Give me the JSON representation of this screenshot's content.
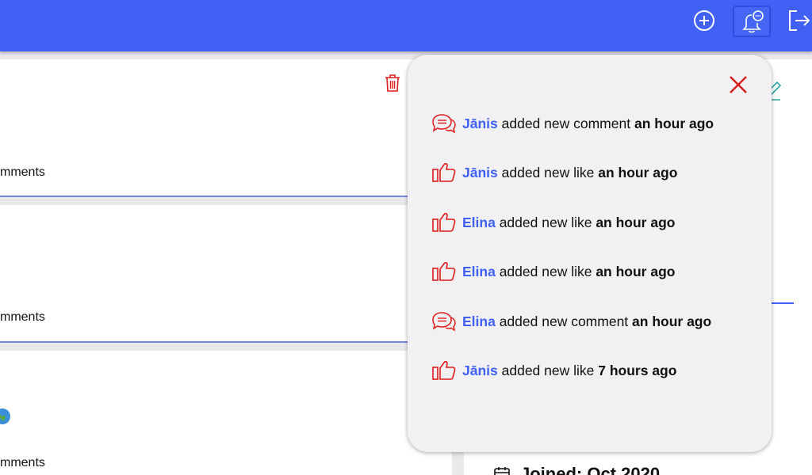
{
  "header": {
    "icons": [
      "plus-circle-icon",
      "bell-chat-icon",
      "logout-icon"
    ]
  },
  "posts": [
    {
      "comments_label": "mments",
      "icon": "trash-icon"
    },
    {
      "comments_label": "mments",
      "icon": "star-icon"
    },
    {
      "comments_label": "mments",
      "icon": "globe-icon"
    }
  ],
  "profile": {
    "joined_label": "Joined: Oct 2020"
  },
  "notifications": {
    "items": [
      {
        "user": "Jānis",
        "action": "added new comment",
        "time": "an hour ago",
        "type": "comment"
      },
      {
        "user": "Jānis",
        "action": "added new like",
        "time": "an hour ago",
        "type": "like"
      },
      {
        "user": "Elina",
        "action": "added new like",
        "time": "an hour ago",
        "type": "like"
      },
      {
        "user": "Elina",
        "action": "added new like",
        "time": "an hour ago",
        "type": "like"
      },
      {
        "user": "Elina",
        "action": "added new comment",
        "time": "an hour ago",
        "type": "comment"
      },
      {
        "user": "Jānis",
        "action": "added new like",
        "time": "7 hours ago",
        "type": "like"
      }
    ]
  },
  "colors": {
    "topbar": "#4161f5",
    "username": "#4161f5",
    "accent_red": "#e01b1b"
  }
}
